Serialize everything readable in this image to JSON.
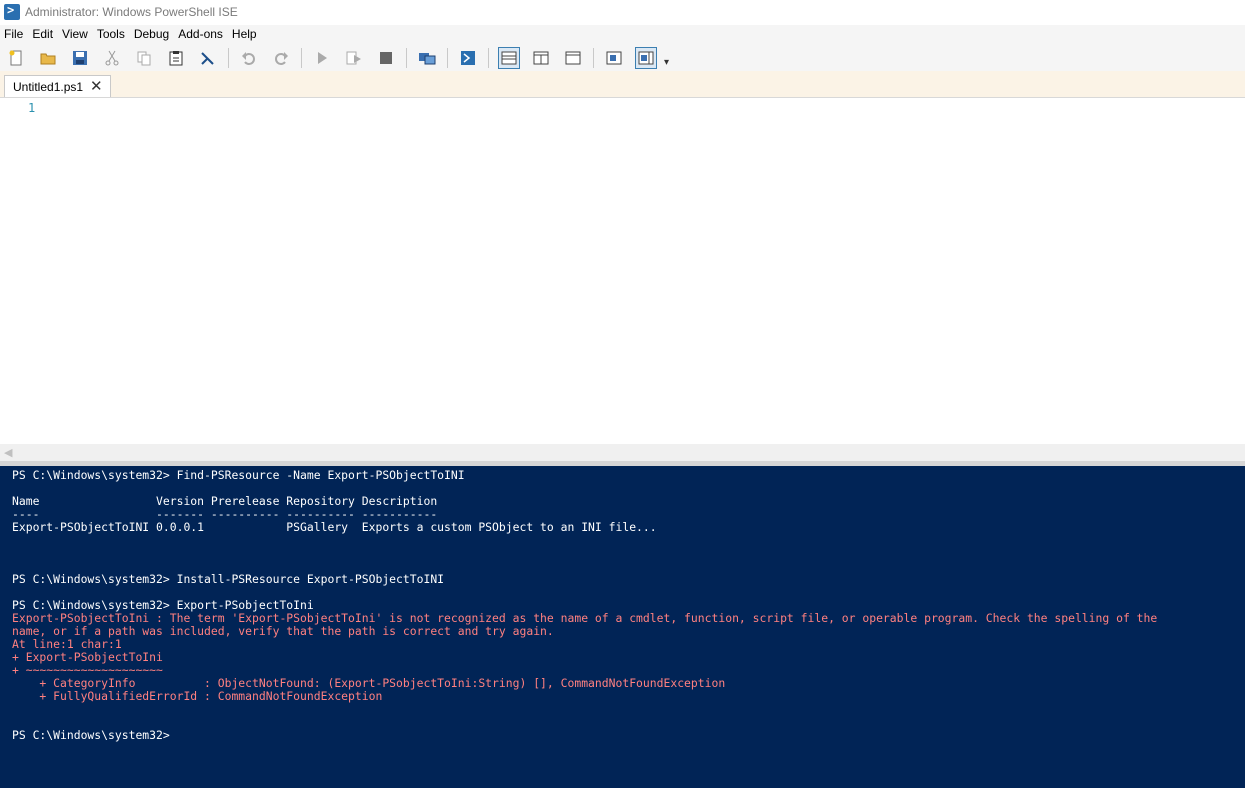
{
  "window": {
    "title": "Administrator: Windows PowerShell ISE"
  },
  "menu": [
    "File",
    "Edit",
    "View",
    "Tools",
    "Debug",
    "Add-ons",
    "Help"
  ],
  "toolbar": {
    "buttons": [
      "new-file-icon",
      "open-folder-icon",
      "save-icon",
      "cut-icon",
      "copy-icon",
      "paste-icon",
      "clear-console-icon",
      "undo-icon",
      "redo-icon",
      "run-script-icon",
      "run-selection-icon",
      "stop-icon",
      "remote-powershell-icon",
      "start-powershell-icon",
      "show-script-pane-top-icon",
      "show-script-pane-right-icon",
      "show-script-pane-maximized-icon",
      "show-command-window-icon",
      "show-command-addon-icon"
    ],
    "accent": "#3c7fb1"
  },
  "tab": {
    "label": "Untitled1.ps1",
    "close": "✕"
  },
  "editor": {
    "line_number": "1"
  },
  "console": {
    "background": "#012456",
    "lines": [
      {
        "text": "PS C:\\Windows\\system32> Find-PSResource -Name Export-PSObjectToINI",
        "kind": "out"
      },
      {
        "text": "Name                 Version Prerelease Repository Description",
        "kind": "out"
      },
      {
        "text": "----                 ------- ---------- ---------- -----------",
        "kind": "out"
      },
      {
        "text": "Export-PSObjectToINI 0.0.0.1            PSGallery  Exports a custom PSObject to an INI file...",
        "kind": "out"
      },
      {
        "text": "PS C:\\Windows\\system32> Install-PSResource Export-PSObjectToINI",
        "kind": "out"
      },
      {
        "text": "PS C:\\Windows\\system32> Export-PSobjectToIni",
        "kind": "out"
      },
      {
        "text": "Export-PSobjectToIni : The term 'Export-PSobjectToIni' is not recognized as the name of a cmdlet, function, script file, or operable program. Check the spelling of the",
        "kind": "err"
      },
      {
        "text": "name, or if a path was included, verify that the path is correct and try again.",
        "kind": "err"
      },
      {
        "text": "At line:1 char:1",
        "kind": "err"
      },
      {
        "text": "+ Export-PSobjectToIni",
        "kind": "err"
      },
      {
        "text": "+ ~~~~~~~~~~~~~~~~~~~~",
        "kind": "err"
      },
      {
        "text": "    + CategoryInfo          : ObjectNotFound: (Export-PSobjectToIni:String) [], CommandNotFoundException",
        "kind": "err"
      },
      {
        "text": "    + FullyQualifiedErrorId : CommandNotFoundException",
        "kind": "err"
      },
      {
        "text": "PS C:\\Windows\\system32>",
        "kind": "out"
      }
    ]
  }
}
